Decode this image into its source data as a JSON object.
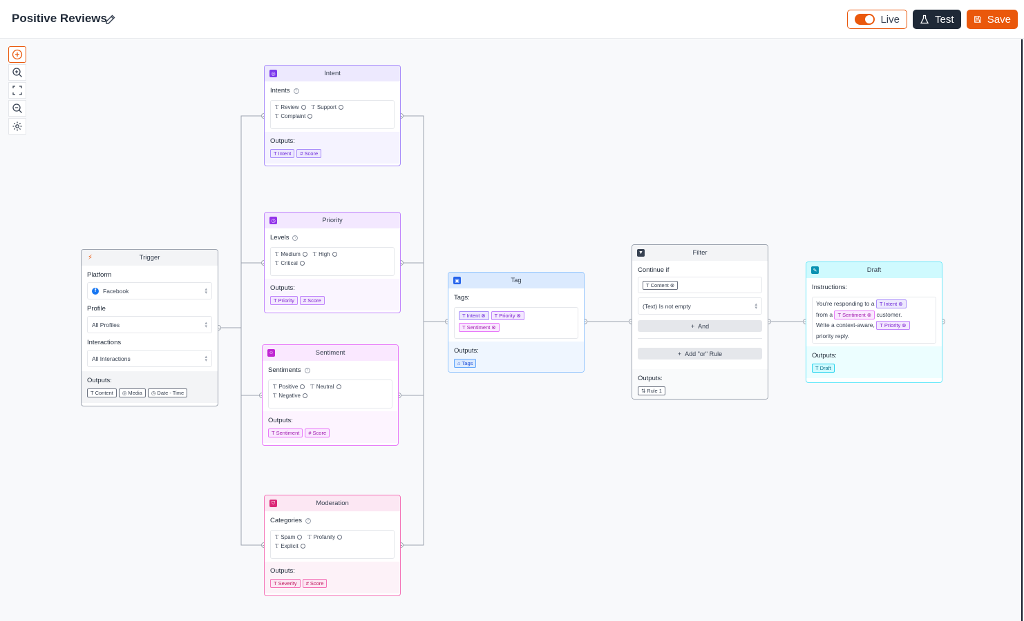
{
  "header": {
    "title": "Positive Reviews",
    "live_label": "Live",
    "test_label": "Test",
    "save_label": "Save"
  },
  "colors": {
    "accent": "#ea580c",
    "intent": "#7c3aed",
    "priority": "#9333ea",
    "sentiment": "#c026d3",
    "moderation": "#db2777",
    "tag": "#2563eb",
    "draft": "#0891b2"
  },
  "toolbar": {
    "icons": [
      "plus-circle-icon",
      "zoom-in-icon",
      "fit-view-icon",
      "zoom-out-icon",
      "settings-icon"
    ]
  },
  "trigger": {
    "title": "Trigger",
    "platform_label": "Platform",
    "platform_value": "Facebook",
    "profile_label": "Profile",
    "profile_value": "All Profiles",
    "interactions_label": "Interactions",
    "interactions_value": "All Interactions",
    "outputs_label": "Outputs:",
    "outputs": [
      "Content",
      "Media",
      "Date - Time"
    ]
  },
  "intent": {
    "title": "Intent",
    "field_label": "Intents",
    "items": [
      "Review",
      "Support",
      "Complaint"
    ],
    "outputs_label": "Outputs:",
    "outputs": [
      "Intent",
      "Score"
    ]
  },
  "priority": {
    "title": "Priority",
    "field_label": "Levels",
    "items": [
      "Medium",
      "High",
      "Critical"
    ],
    "outputs_label": "Outputs:",
    "outputs": [
      "Priority",
      "Score"
    ]
  },
  "sentiment": {
    "title": "Sentiment",
    "field_label": "Sentiments",
    "items": [
      "Positive",
      "Neutral",
      "Negative"
    ],
    "outputs_label": "Outputs:",
    "outputs": [
      "Sentiment",
      "Score"
    ]
  },
  "moderation": {
    "title": "Moderation",
    "field_label": "Categories",
    "items": [
      "Spam",
      "Profanity",
      "Explicit"
    ],
    "outputs_label": "Outputs:",
    "outputs": [
      "Severity",
      "Score"
    ]
  },
  "tag": {
    "title": "Tag",
    "field_label": "Tags:",
    "items": [
      "Intent",
      "Priority",
      "Sentiment"
    ],
    "outputs_label": "Outputs:",
    "outputs": [
      "Tags"
    ]
  },
  "filter": {
    "title": "Filter",
    "continue_label": "Continue if",
    "condition_field": "Content",
    "condition_op": "(Text) Is not empty",
    "and_label": "And",
    "or_label": "Add \"or\" Rule",
    "outputs_label": "Outputs:",
    "outputs": [
      "Rule 1"
    ]
  },
  "draft": {
    "title": "Draft",
    "instructions_label": "Instructions:",
    "text1": "You're responding to a",
    "var1": "Intent",
    "text2": "from a",
    "var2": "Sentiment",
    "text3": "customer.",
    "text4": "Write a context-aware,",
    "var3": "Priority",
    "text5": "priority reply.",
    "outputs_label": "Outputs:",
    "outputs": [
      "Draft"
    ]
  }
}
